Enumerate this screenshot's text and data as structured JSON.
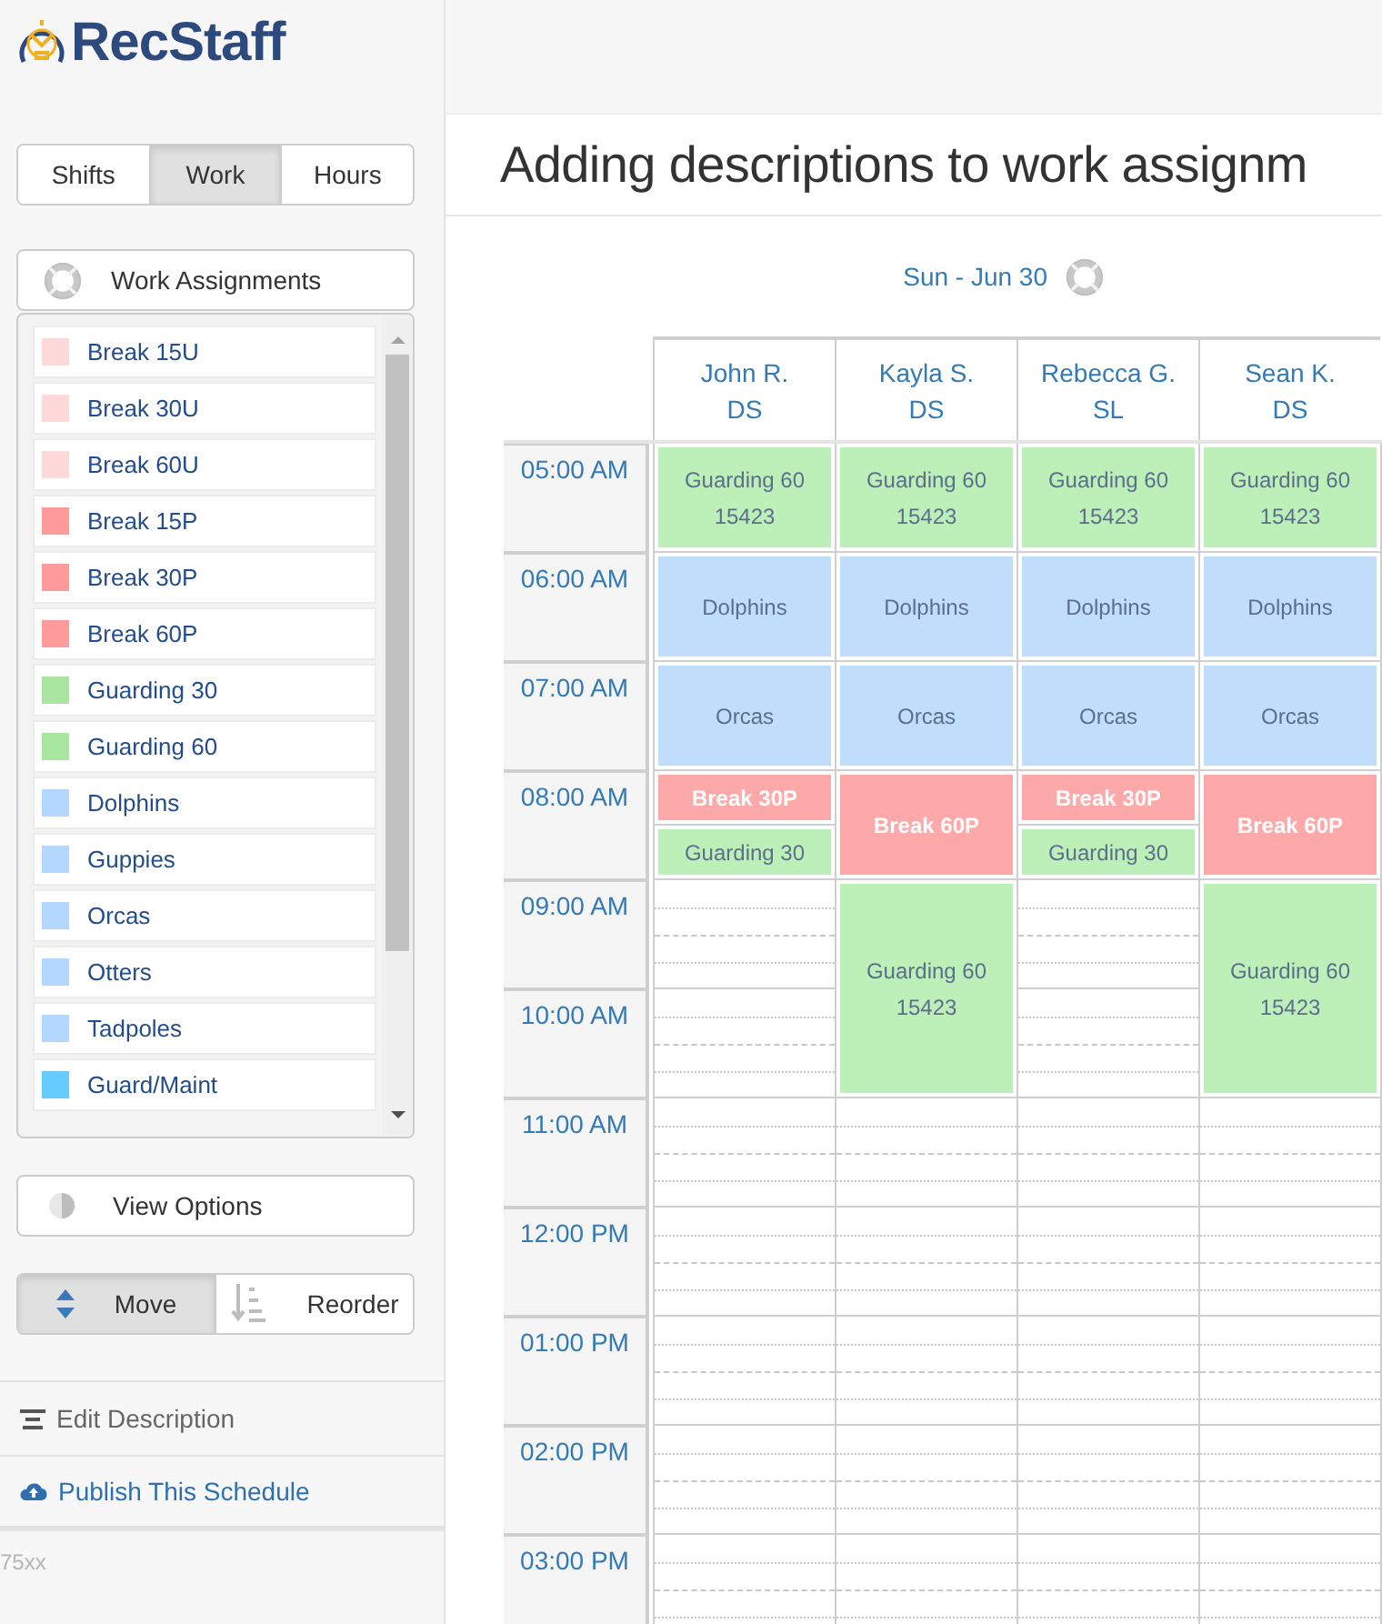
{
  "logo": {
    "text": "RecStaff"
  },
  "view_tabs": [
    {
      "label": "Shifts",
      "selected": false
    },
    {
      "label": "Work",
      "selected": true
    },
    {
      "label": "Hours",
      "selected": false
    }
  ],
  "assignments_panel": {
    "title": "Work Assignments",
    "items": [
      {
        "label": "Break 15U",
        "color": "#ffd9d9"
      },
      {
        "label": "Break 30U",
        "color": "#ffd9d9"
      },
      {
        "label": "Break 60U",
        "color": "#ffd9d9"
      },
      {
        "label": "Break 15P",
        "color": "#fd9a9a"
      },
      {
        "label": "Break 30P",
        "color": "#fd9a9a"
      },
      {
        "label": "Break 60P",
        "color": "#fd9a9a"
      },
      {
        "label": "Guarding 30",
        "color": "#a8e6a0"
      },
      {
        "label": "Guarding 60",
        "color": "#a8e6a0"
      },
      {
        "label": "Dolphins",
        "color": "#b3d7ff"
      },
      {
        "label": "Guppies",
        "color": "#b3d7ff"
      },
      {
        "label": "Orcas",
        "color": "#b3d7ff"
      },
      {
        "label": "Otters",
        "color": "#b3d7ff"
      },
      {
        "label": "Tadpoles",
        "color": "#b3d7ff"
      },
      {
        "label": "Guard/Maint",
        "color": "#66ccff"
      }
    ]
  },
  "view_options": {
    "label": "View Options"
  },
  "mode_toggle": [
    {
      "label": "Move",
      "selected": true
    },
    {
      "label": "Reorder",
      "selected": false
    }
  ],
  "sidebar_links": [
    {
      "label": "Edit Description",
      "kind": "description"
    },
    {
      "label": "Publish This Schedule",
      "kind": "publish"
    }
  ],
  "footer_note": "75xx",
  "page_title": "Adding descriptions to work assignm",
  "schedule": {
    "date": "Sun - Jun 30",
    "times": [
      "05:00 AM",
      "06:00 AM",
      "07:00 AM",
      "08:00 AM",
      "09:00 AM",
      "10:00 AM",
      "11:00 AM",
      "12:00 PM",
      "01:00 PM",
      "02:00 PM",
      "03:00 PM"
    ],
    "staff": [
      {
        "name": "John R.",
        "role": "DS",
        "blocks": [
          {
            "label": "Guarding 60",
            "code": "15423",
            "kind": "work_hour",
            "color": "#bdefb9"
          },
          {
            "label": "Dolphins",
            "kind": "work_hour",
            "color": "#c0ddfb"
          },
          {
            "label": "Orcas",
            "kind": "work_hour",
            "color": "#c0ddfb"
          },
          {
            "label": "Break 30P",
            "kind": "break_half",
            "color": "#fda9a9"
          },
          {
            "label": "Guarding 30",
            "kind": "work_half",
            "color": "#bdefb9"
          }
        ]
      },
      {
        "name": "Kayla S.",
        "role": "DS",
        "blocks": [
          {
            "label": "Guarding 60",
            "code": "15423",
            "kind": "work_hour",
            "color": "#bdefb9"
          },
          {
            "label": "Dolphins",
            "kind": "work_hour",
            "color": "#c0ddfb"
          },
          {
            "label": "Orcas",
            "kind": "work_hour",
            "color": "#c0ddfb"
          },
          {
            "label": "Break 60P",
            "kind": "break_hour",
            "color": "#fda9a9"
          },
          {
            "label": "Guarding 60",
            "code": "15423",
            "kind": "work_two_hours",
            "color": "#bdefb9"
          }
        ]
      },
      {
        "name": "Rebecca G.",
        "role": "SL",
        "blocks": [
          {
            "label": "Guarding 60",
            "code": "15423",
            "kind": "work_hour",
            "color": "#bdefb9"
          },
          {
            "label": "Dolphins",
            "kind": "work_hour",
            "color": "#c0ddfb"
          },
          {
            "label": "Orcas",
            "kind": "work_hour",
            "color": "#c0ddfb"
          },
          {
            "label": "Break 30P",
            "kind": "break_half",
            "color": "#fda9a9"
          },
          {
            "label": "Guarding 30",
            "kind": "work_half",
            "color": "#bdefb9"
          }
        ]
      },
      {
        "name": "Sean K.",
        "role": "DS",
        "blocks": [
          {
            "label": "Guarding 60",
            "code": "15423",
            "kind": "work_hour",
            "color": "#bdefb9"
          },
          {
            "label": "Dolphins",
            "kind": "work_hour",
            "color": "#c0ddfb"
          },
          {
            "label": "Orcas",
            "kind": "work_hour",
            "color": "#c0ddfb"
          },
          {
            "label": "Break 60P",
            "kind": "break_hour",
            "color": "#fda9a9"
          },
          {
            "label": "Guarding 60",
            "code": "15423",
            "kind": "work_two_hours",
            "color": "#bdefb9"
          }
        ]
      }
    ]
  }
}
